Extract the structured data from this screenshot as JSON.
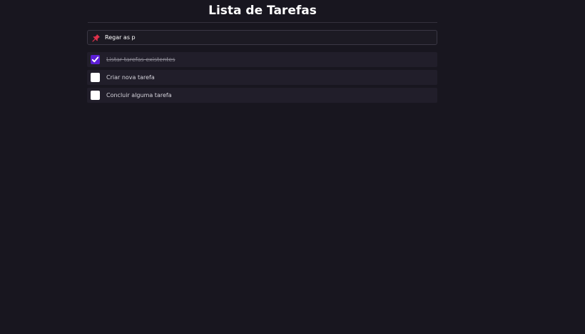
{
  "header": {
    "title": "Lista de Tarefas"
  },
  "new_task": {
    "value": "Regar as p",
    "icon": "pushpin-icon"
  },
  "tasks": [
    {
      "label": "Listar tarefas existentes",
      "done": true
    },
    {
      "label": "Criar nova tarefa",
      "done": false
    },
    {
      "label": "Concluir alguma tarefa",
      "done": false
    }
  ],
  "colors": {
    "background": "#18161f",
    "task_background": "#211e2a",
    "checkbox_checked": "#5c1ed6",
    "pin": "#e0314b"
  }
}
